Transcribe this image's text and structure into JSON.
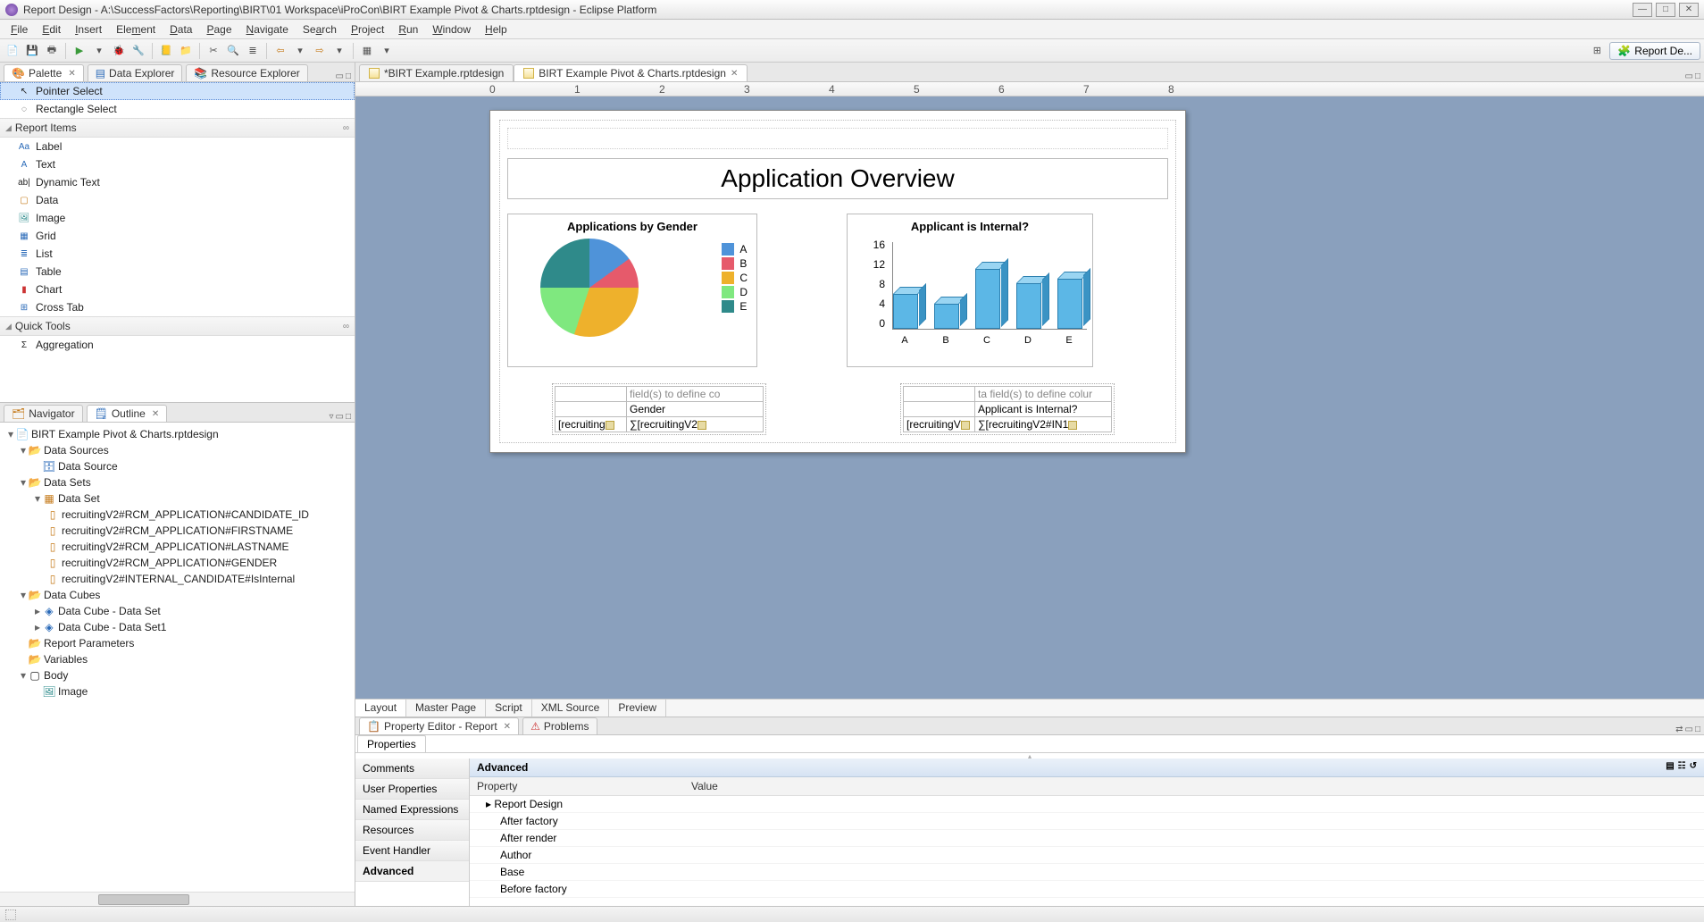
{
  "title": "Report Design - A:\\SuccessFactors\\Reporting\\BIRT\\01 Workspace\\iProCon\\BIRT Example Pivot & Charts.rptdesign - Eclipse Platform",
  "menu": [
    "File",
    "Edit",
    "Insert",
    "Element",
    "Data",
    "Page",
    "Navigate",
    "Search",
    "Project",
    "Run",
    "Window",
    "Help"
  ],
  "perspective": "Report De...",
  "left_tabs": {
    "palette": "Palette",
    "data_explorer": "Data Explorer",
    "resource_explorer": "Resource Explorer"
  },
  "palette": {
    "pointer": "Pointer Select",
    "rectangle": "Rectangle Select",
    "section_items": "Report Items",
    "items": [
      "Label",
      "Text",
      "Dynamic Text",
      "Data",
      "Image",
      "Grid",
      "List",
      "Table",
      "Chart",
      "Cross Tab"
    ],
    "section_quick": "Quick Tools",
    "quick_items": [
      "Aggregation"
    ]
  },
  "nav_tabs": {
    "navigator": "Navigator",
    "outline": "Outline"
  },
  "outline": {
    "root": "BIRT Example Pivot & Charts.rptdesign",
    "data_sources": "Data Sources",
    "data_source": "Data Source",
    "data_sets": "Data Sets",
    "data_set": "Data Set",
    "cols": [
      "recruitingV2#RCM_APPLICATION#CANDIDATE_ID",
      "recruitingV2#RCM_APPLICATION#FIRSTNAME",
      "recruitingV2#RCM_APPLICATION#LASTNAME",
      "recruitingV2#RCM_APPLICATION#GENDER",
      "recruitingV2#INTERNAL_CANDIDATE#IsInternal"
    ],
    "data_cubes": "Data Cubes",
    "cubes": [
      "Data Cube - Data Set",
      "Data Cube - Data Set1"
    ],
    "report_params": "Report Parameters",
    "variables": "Variables",
    "body": "Body",
    "body_items": [
      "Image"
    ]
  },
  "editor_tabs": [
    "*BIRT Example.rptdesign",
    "BIRT Example Pivot & Charts.rptdesign"
  ],
  "design_tabs": [
    "Layout",
    "Master Page",
    "Script",
    "XML Source",
    "Preview"
  ],
  "report": {
    "title": "Application Overview",
    "chart1_title": "Applications by Gender",
    "chart2_title": "Applicant is Internal?",
    "legend": [
      "A",
      "B",
      "C",
      "D",
      "E"
    ],
    "pivot1": {
      "hint": "field(s) to define co",
      "dim": "Gender",
      "row": "[recruiting",
      "meas": "∑[recruitingV2"
    },
    "pivot2": {
      "hint": "ta field(s) to define colur",
      "dim": "Applicant is Internal?",
      "row": "[recruitingV",
      "meas": "∑[recruitingV2#IN1"
    }
  },
  "bottom_tabs": {
    "prop": "Property Editor - Report",
    "problems": "Problems"
  },
  "prop_sub": "Properties",
  "prop_cats": [
    "Comments",
    "User Properties",
    "Named Expressions",
    "Resources",
    "Event Handler",
    "Advanced"
  ],
  "prop_head": "Advanced",
  "prop_cols": [
    "Property",
    "Value"
  ],
  "prop_rows": [
    "Report Design",
    "After factory",
    "After render",
    "Author",
    "Base",
    "Before factory"
  ],
  "chart_data": [
    {
      "type": "pie",
      "title": "Applications by Gender",
      "categories": [
        "A",
        "B",
        "C",
        "D",
        "E"
      ],
      "values": [
        15,
        10,
        30,
        20,
        25
      ],
      "colors": [
        "#4f93d9",
        "#e65a6b",
        "#eeb12c",
        "#7fe87f",
        "#2f8a8a"
      ]
    },
    {
      "type": "bar",
      "title": "Applicant is Internal?",
      "categories": [
        "A",
        "B",
        "C",
        "D",
        "E"
      ],
      "values": [
        7,
        5,
        12,
        9,
        10
      ],
      "ylim": [
        0,
        16
      ],
      "yticks": [
        0,
        4,
        8,
        12,
        16
      ],
      "xlabel": "",
      "ylabel": ""
    }
  ]
}
